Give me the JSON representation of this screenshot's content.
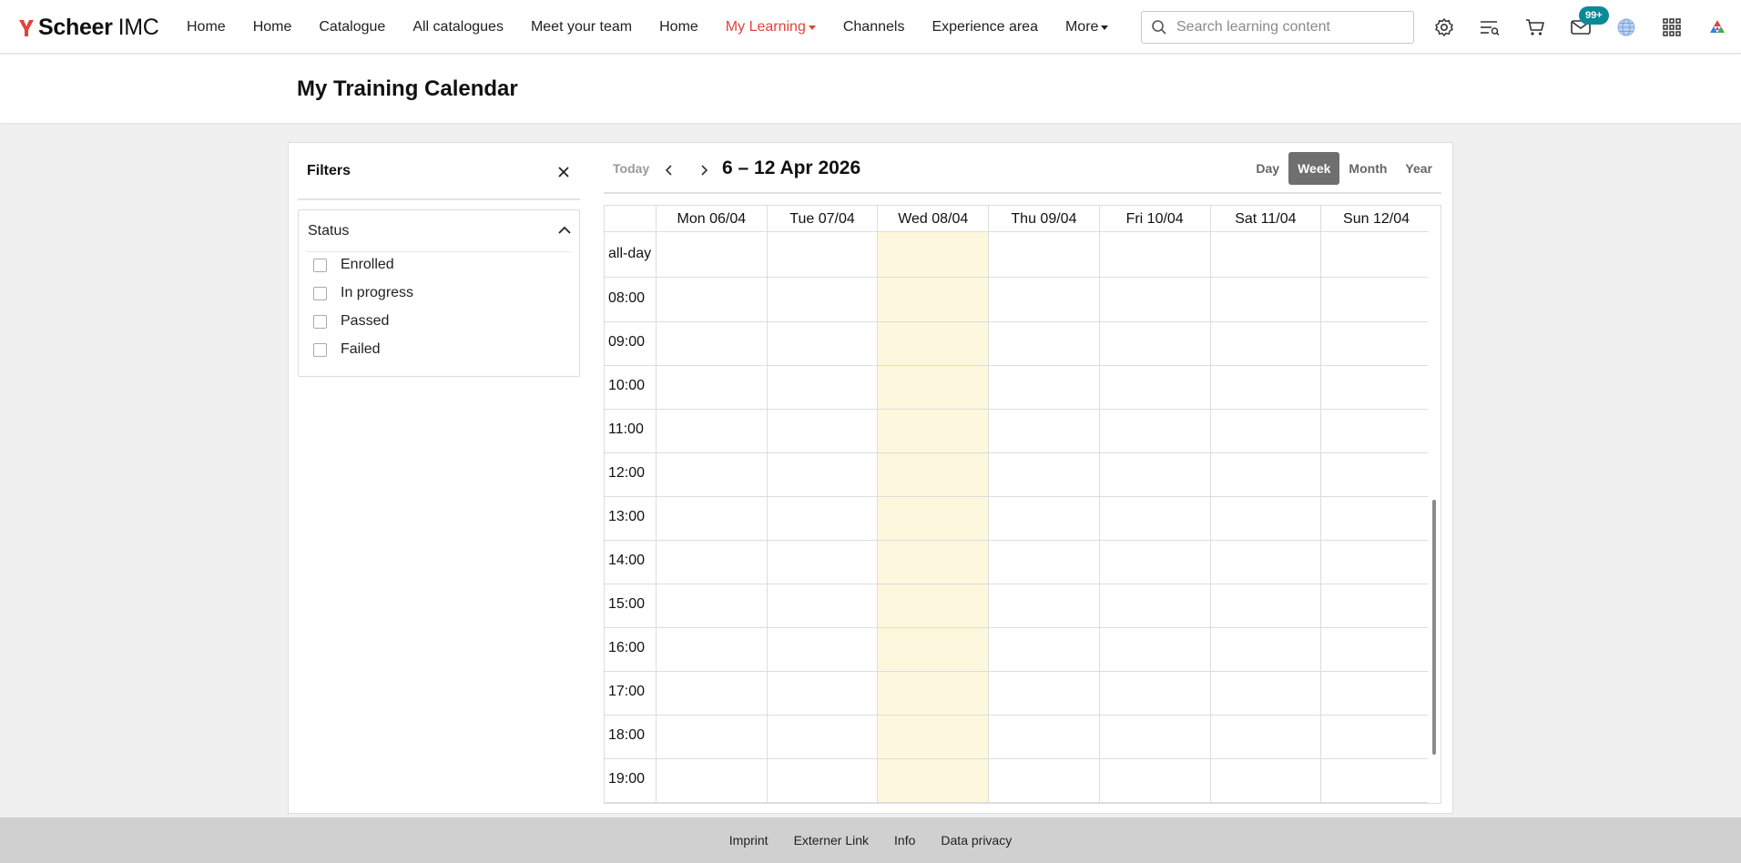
{
  "brand": {
    "name_bold": "Scheer",
    "name_light": "IMC",
    "accent": "#e0443a"
  },
  "nav": {
    "items": [
      {
        "label": "Home"
      },
      {
        "label": "Home"
      },
      {
        "label": "Catalogue"
      },
      {
        "label": "All catalogues"
      },
      {
        "label": "Meet your team"
      },
      {
        "label": "Home"
      },
      {
        "label": "My Learning",
        "active": true,
        "has_dropdown": true
      },
      {
        "label": "Channels"
      },
      {
        "label": "Experience area"
      },
      {
        "label": "More",
        "has_dropdown": true
      }
    ]
  },
  "search": {
    "placeholder": "Search learning content",
    "value": ""
  },
  "toolbar_icons": [
    "settings-icon",
    "learning-list-icon",
    "cart-icon",
    "mail-icon",
    "globe-icon",
    "apps-grid-icon",
    "colorful-logo-icon"
  ],
  "mail": {
    "badge": "99+"
  },
  "page": {
    "title": "My Training Calendar"
  },
  "filters": {
    "title": "Filters",
    "status": {
      "label": "Status",
      "options": [
        {
          "label": "Enrolled",
          "checked": false
        },
        {
          "label": "In progress",
          "checked": false
        },
        {
          "label": "Passed",
          "checked": false
        },
        {
          "label": "Failed",
          "checked": false
        }
      ]
    }
  },
  "calendar": {
    "today_label": "Today",
    "range": "6 – 12 Apr 2026",
    "views": [
      {
        "label": "Day",
        "active": false
      },
      {
        "label": "Week",
        "active": true
      },
      {
        "label": "Month",
        "active": false
      },
      {
        "label": "Year",
        "active": false
      }
    ],
    "days": [
      "Mon 06/04",
      "Tue 07/04",
      "Wed 08/04",
      "Thu 09/04",
      "Fri 10/04",
      "Sat 11/04",
      "Sun 12/04"
    ],
    "today_index": 2,
    "allday_label": "all-day",
    "hours": [
      "08:00",
      "09:00",
      "10:00",
      "11:00",
      "12:00",
      "13:00",
      "14:00",
      "15:00",
      "16:00",
      "17:00",
      "18:00",
      "19:00"
    ],
    "today_color": "#fdf7dd"
  },
  "footer": {
    "links": [
      "Imprint",
      "Externer Link",
      "Info",
      "Data privacy"
    ]
  }
}
